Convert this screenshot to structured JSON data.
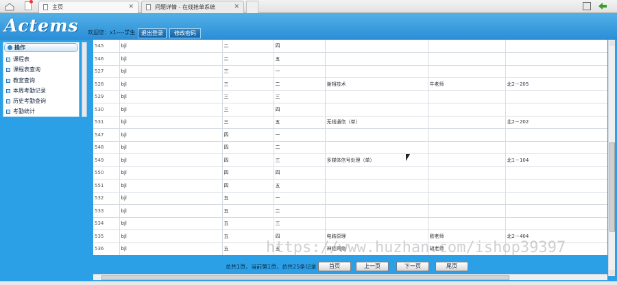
{
  "browser": {
    "tabs": [
      {
        "label": "主页",
        "close": "✕"
      },
      {
        "label": "问题详情 - 在线抢单系统",
        "close": "✕"
      }
    ]
  },
  "header": {
    "logo": "Actems",
    "welcome": "欢迎您：x1----学生",
    "logout_label": "退出登录",
    "change_password_label": "修改密码"
  },
  "sidebar": {
    "title": "操作",
    "items": [
      "课程表",
      "课程表查询",
      "教室查询",
      "本周考勤记录",
      "历史考勤查询",
      "考勤统计"
    ]
  },
  "table": {
    "rows": [
      [
        "545",
        "bjl",
        "二",
        "四",
        "",
        "",
        ""
      ],
      [
        "546",
        "bjl",
        "二",
        "五",
        "",
        "",
        ""
      ],
      [
        "527",
        "bjl",
        "三",
        "一",
        "",
        "",
        ""
      ],
      [
        "528",
        "bjl",
        "三",
        "二",
        "谢相技术",
        "牛老师",
        "北2－205"
      ],
      [
        "529",
        "bjl",
        "三",
        "三",
        "",
        "",
        ""
      ],
      [
        "530",
        "bjl",
        "三",
        "四",
        "",
        "",
        ""
      ],
      [
        "531",
        "bjl",
        "三",
        "五",
        "无线通信（单）",
        "",
        "北2－202"
      ],
      [
        "547",
        "bjl",
        "四",
        "一",
        "",
        "",
        ""
      ],
      [
        "548",
        "bjl",
        "四",
        "二",
        "",
        "",
        ""
      ],
      [
        "549",
        "bjl",
        "四",
        "三",
        "多媒体信号处理（单）",
        "",
        "北1－104"
      ],
      [
        "550",
        "bjl",
        "四",
        "四",
        "",
        "",
        ""
      ],
      [
        "551",
        "bjl",
        "四",
        "五",
        "",
        "",
        ""
      ],
      [
        "532",
        "bjl",
        "五",
        "一",
        "",
        "",
        ""
      ],
      [
        "533",
        "bjl",
        "五",
        "二",
        "",
        "",
        ""
      ],
      [
        "534",
        "bjl",
        "五",
        "三",
        "",
        "",
        ""
      ],
      [
        "535",
        "bjl",
        "五",
        "四",
        "电路原理",
        "欧老师",
        "北2－404"
      ],
      [
        "536",
        "bjl",
        "五",
        "五",
        "神经网络",
        "胡老师",
        ""
      ]
    ]
  },
  "pager": {
    "info": "总共1页，当前第1页，总共25条记录",
    "first": "首页",
    "prev": "上一页",
    "next": "下一页",
    "last": "尾页"
  },
  "watermark": "https://www.huzhan.com/ishop39397"
}
